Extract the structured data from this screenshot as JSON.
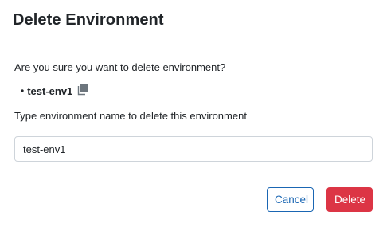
{
  "dialog": {
    "title": "Delete Environment",
    "confirm_text": "Are you sure you want to delete environment?",
    "bullet": "•",
    "environment_name": "test-env1",
    "prompt_text": "Type environment name to delete this environment",
    "input_value": "test-env1",
    "copy_icon": "copy-icon",
    "cancel_label": "Cancel",
    "delete_label": "Delete",
    "colors": {
      "cancel_border": "#1a66b3",
      "delete_bg": "#dc3545"
    }
  }
}
